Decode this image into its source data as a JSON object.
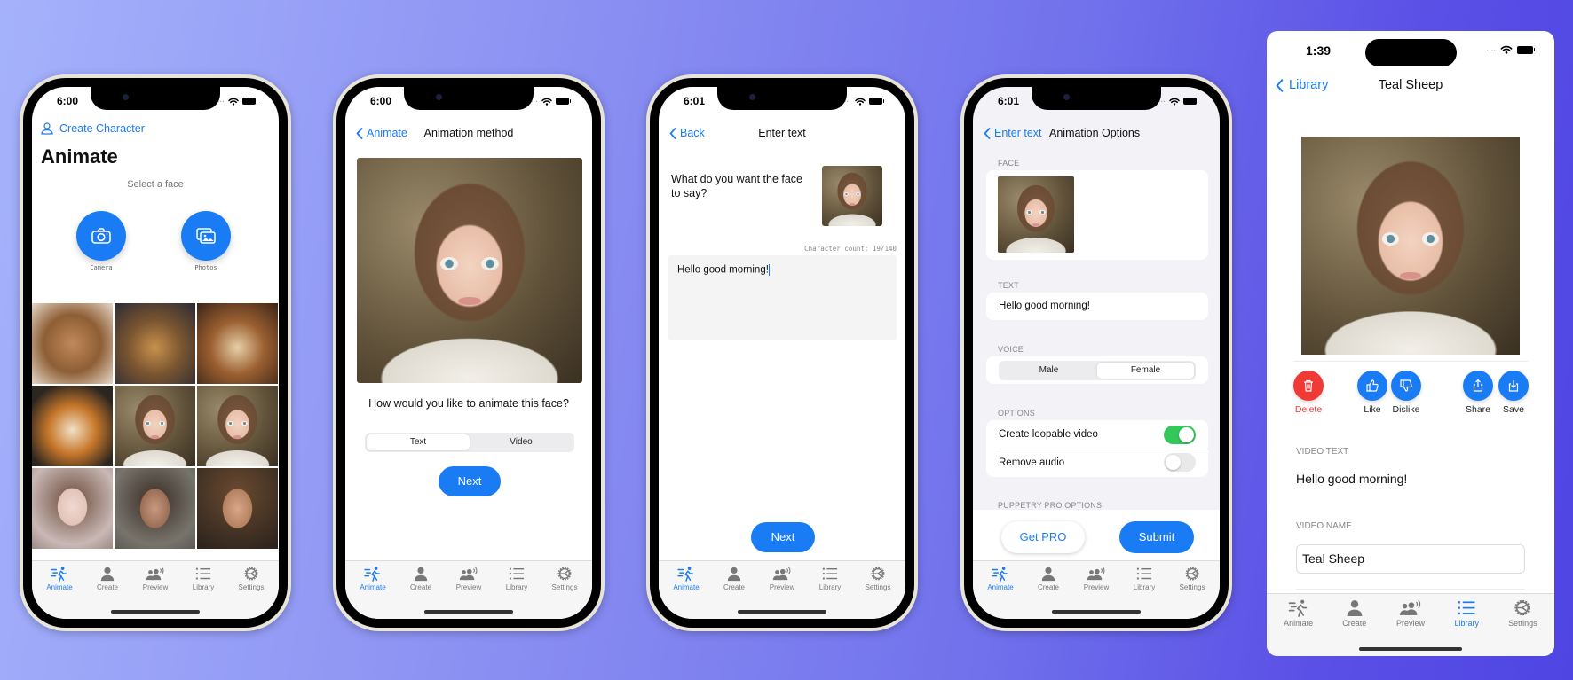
{
  "colors": {
    "accent": "#1a7cf5",
    "toggle_on": "#34c759",
    "destructive": "#f03a35",
    "background_gradient_start": "#a5b2fb",
    "background_gradient_end": "#4f45e3"
  },
  "tabbar": {
    "items": [
      {
        "label": "Animate",
        "icon": "running-figure-icon"
      },
      {
        "label": "Create",
        "icon": "person-icon"
      },
      {
        "label": "Preview",
        "icon": "people-speaking-icon"
      },
      {
        "label": "Library",
        "icon": "list-icon"
      },
      {
        "label": "Settings",
        "icon": "gear-icon"
      }
    ]
  },
  "screen1": {
    "time": "6:00",
    "create_character_link": "Create Character",
    "title": "Animate",
    "subtitle": "Select a face",
    "camera_label": "Camera",
    "photos_label": "Photos",
    "faces": [
      "Tabby cat",
      "Kitten",
      "Dog",
      "Shiba dog",
      "Woman with bob",
      "Woman with bangs",
      "Woman curly hair",
      "Bearded man",
      "Young man"
    ],
    "active_tab": "Animate"
  },
  "screen2": {
    "time": "6:00",
    "back_label": "Animate",
    "nav_title": "Animation method",
    "question": "How would you like to animate this face?",
    "segments": [
      "Text",
      "Video"
    ],
    "selected_segment": "Text",
    "next_button": "Next",
    "active_tab": "Animate"
  },
  "screen3": {
    "time": "6:01",
    "back_label": "Back",
    "nav_title": "Enter text",
    "prompt": "What do you want the face to say?",
    "char_count": "Character count: 19/140",
    "text_value": "Hello good morning!",
    "next_button": "Next",
    "active_tab": "Animate"
  },
  "screen4": {
    "time": "6:01",
    "back_label": "Enter text",
    "nav_title": "Animation Options",
    "face_label": "FACE",
    "text_label": "TEXT",
    "text_value": "Hello good morning!",
    "voice_label": "VOICE",
    "voice_options": [
      "Male",
      "Female"
    ],
    "voice_selected": "Female",
    "options_label": "OPTIONS",
    "options": [
      {
        "label": "Create loopable video",
        "on": true
      },
      {
        "label": "Remove audio",
        "on": false
      }
    ],
    "pro_label": "PUPPETRY PRO OPTIONS",
    "get_pro_button": "Get PRO",
    "submit_button": "Submit",
    "active_tab": "Animate"
  },
  "screen5": {
    "time": "1:39",
    "back_label": "Library",
    "nav_title": "Teal Sheep",
    "actions": [
      {
        "label": "Delete",
        "icon": "trash-icon"
      },
      {
        "label": "Like",
        "icon": "thumbs-up-icon"
      },
      {
        "label": "Dislike",
        "icon": "thumbs-down-icon"
      },
      {
        "label": "Share",
        "icon": "share-icon"
      },
      {
        "label": "Save",
        "icon": "save-icon"
      }
    ],
    "video_text_label": "VIDEO TEXT",
    "video_text_value": "Hello good morning!",
    "video_name_label": "VIDEO NAME",
    "video_name_value": "Teal Sheep",
    "active_tab": "Library"
  }
}
